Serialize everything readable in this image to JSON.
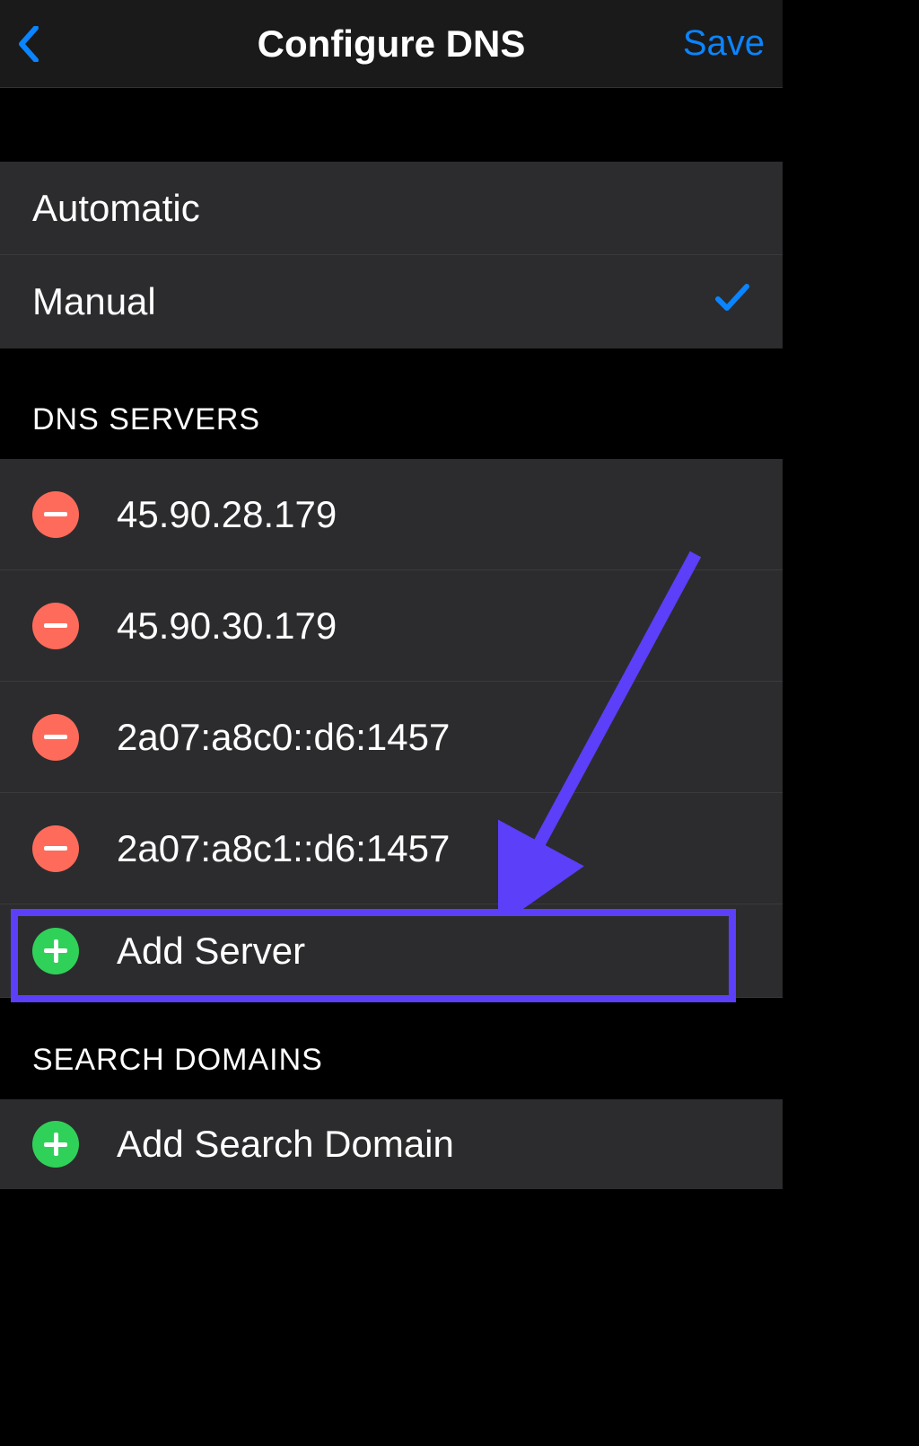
{
  "nav": {
    "title": "Configure DNS",
    "save_label": "Save"
  },
  "mode_options": {
    "automatic": "Automatic",
    "manual": "Manual",
    "selected": "manual"
  },
  "dns_servers": {
    "header": "DNS SERVERS",
    "entries": [
      "45.90.28.179",
      "45.90.30.179",
      "2a07:a8c0::d6:1457",
      "2a07:a8c1::d6:1457"
    ],
    "add_label": "Add Server"
  },
  "search_domains": {
    "header": "SEARCH DOMAINS",
    "add_label": "Add Search Domain"
  },
  "annotation": {
    "highlight_color": "#5b3ff9"
  }
}
